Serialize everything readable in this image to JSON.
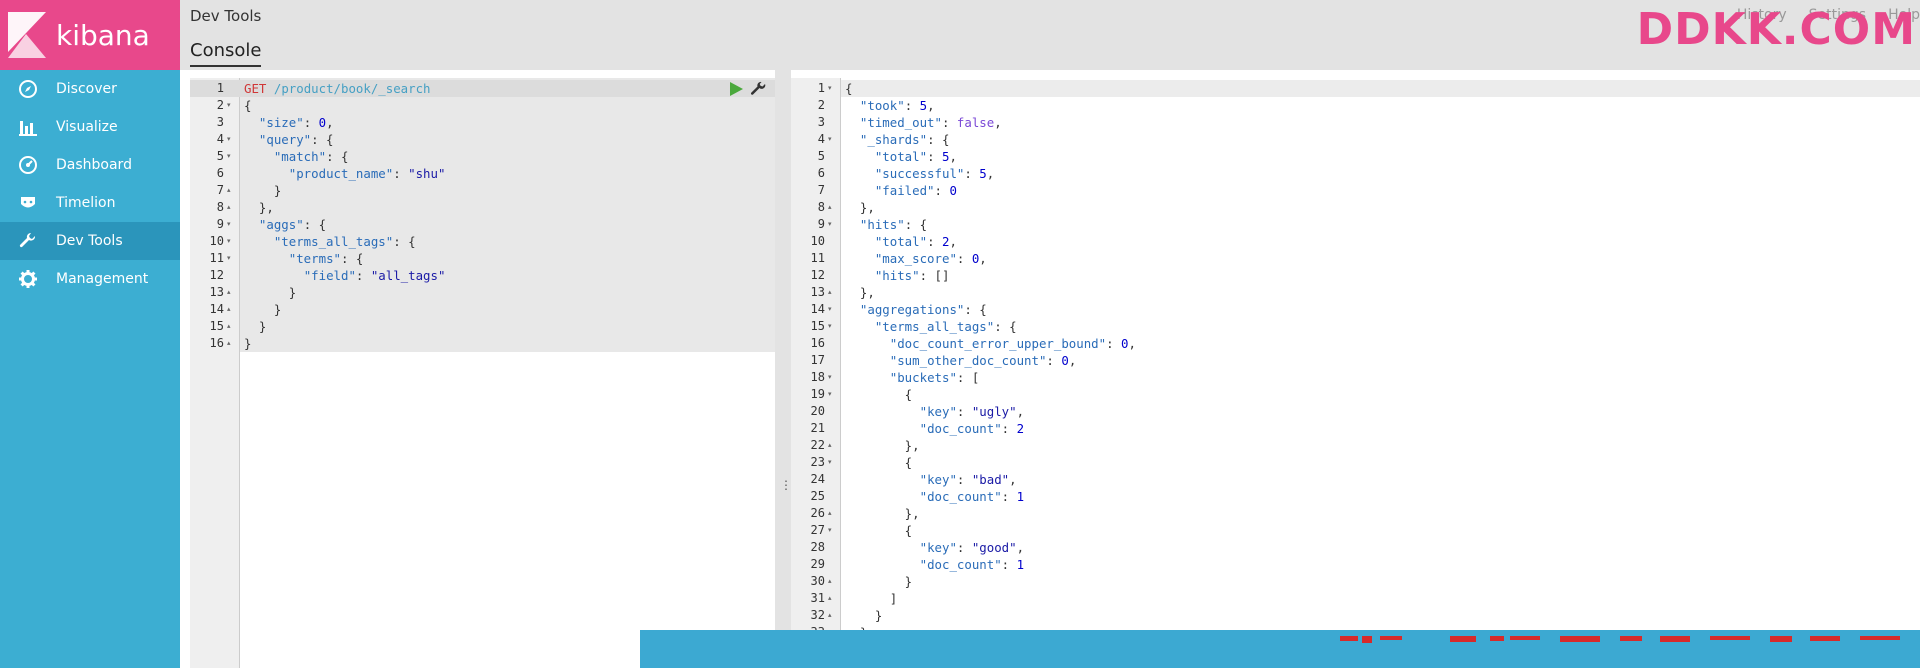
{
  "brand": {
    "name": "kibana",
    "accent": "#e8488b",
    "sidebar_color": "#3caed2"
  },
  "sidebar": {
    "items": [
      {
        "label": "Discover",
        "icon": "compass-icon"
      },
      {
        "label": "Visualize",
        "icon": "bar-chart-icon"
      },
      {
        "label": "Dashboard",
        "icon": "dashboard-icon"
      },
      {
        "label": "Timelion",
        "icon": "timelion-icon"
      },
      {
        "label": "Dev Tools",
        "icon": "wrench-icon",
        "active": true
      },
      {
        "label": "Management",
        "icon": "gear-icon"
      }
    ]
  },
  "header": {
    "title": "Dev Tools",
    "tab": "Console",
    "links": [
      "History",
      "Settings",
      "Help"
    ],
    "watermark": "DDKK.COM"
  },
  "request": {
    "lines": [
      "GET /product/book/_search",
      "{",
      "  \"size\": 0,",
      "  \"query\": {",
      "    \"match\": {",
      "      \"product_name\": \"shu\"",
      "    }",
      "  },",
      "  \"aggs\": {",
      "    \"terms_all_tags\": {",
      "      \"terms\": {",
      "        \"field\": \"all_tags\"",
      "      }",
      "    }",
      "  }",
      "}"
    ]
  },
  "response": {
    "lines": [
      "{",
      "  \"took\": 5,",
      "  \"timed_out\": false,",
      "  \"_shards\": {",
      "    \"total\": 5,",
      "    \"successful\": 5,",
      "    \"failed\": 0",
      "  },",
      "  \"hits\": {",
      "    \"total\": 2,",
      "    \"max_score\": 0,",
      "    \"hits\": []",
      "  },",
      "  \"aggregations\": {",
      "    \"terms_all_tags\": {",
      "      \"doc_count_error_upper_bound\": 0,",
      "      \"sum_other_doc_count\": 0,",
      "      \"buckets\": [",
      "        {",
      "          \"key\": \"ugly\",",
      "          \"doc_count\": 2",
      "        },",
      "        {",
      "          \"key\": \"bad\",",
      "          \"doc_count\": 1",
      "        },",
      "        {",
      "          \"key\": \"good\",",
      "          \"doc_count\": 1",
      "        }",
      "      ]",
      "    }",
      "  }",
      "}"
    ]
  }
}
